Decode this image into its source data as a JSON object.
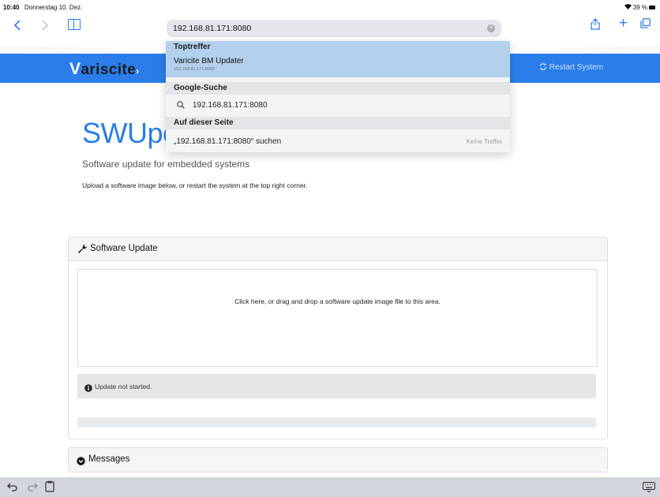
{
  "statusbar": {
    "time": "10:40",
    "date": "Donnerstag 10. Dez.",
    "battery": "39 %"
  },
  "browser": {
    "url": "192.168.81.171:8080",
    "accent_color": "#2b7cf6"
  },
  "dropdown": {
    "top_hits_header": "Toptreffer",
    "top_hit_title": "Varicite BM Updater",
    "top_hit_url": "192.168.81.171:8080",
    "google_header": "Google-Suche",
    "google_query": "192.168.81.171:8080",
    "on_page_header": "Auf dieser Seite",
    "find_text": "„192.168.81.171:8080“ suchen",
    "no_results": "Keine Treffer"
  },
  "navbar": {
    "brand_v": "V",
    "brand_rest": "ariscite",
    "restart_label": "Restart System",
    "color": "#2b7de9"
  },
  "hero": {
    "title": "SWUpc",
    "subtitle": "Software update for embedded systems",
    "description": "Upload a software image below, or restart the system at the top right corner."
  },
  "update_panel": {
    "title": "Software Update",
    "dropzone_text": "Click here, or drag and drop a software update image file to this area.",
    "status_text": "Update not started.",
    "progress": 0
  },
  "messages_panel": {
    "title": "Messages"
  },
  "icons": [
    "chevron-left-icon",
    "chevron-right-icon",
    "bookmarks-icon",
    "clear-icon",
    "share-icon",
    "plus-icon",
    "tabs-icon",
    "refresh-icon",
    "search-icon",
    "wrench-icon",
    "info-icon",
    "chevron-circle-down-icon",
    "undo-icon",
    "redo-icon",
    "paste-icon",
    "keyboard-icon"
  ]
}
